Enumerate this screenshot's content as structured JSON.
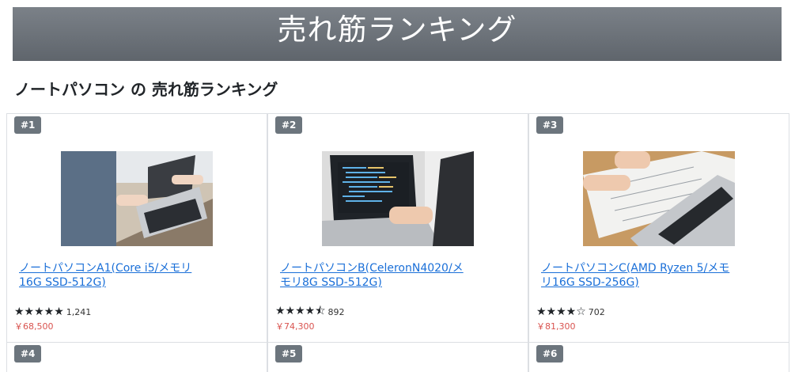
{
  "header": {
    "title": "売れ筋ランキング"
  },
  "section": {
    "title": "ノートパソコン の 売れ筋ランキング"
  },
  "products": [
    {
      "rank": "#1",
      "name": "ノートパソコンA1(Core i5/メモリ16G SSD-512G)",
      "stars": "★★★★★",
      "review_count": "1,241",
      "price": "￥68,500",
      "image": "laptop-photo"
    },
    {
      "rank": "#2",
      "name": "ノートパソコンB(CeleronN4020/メモリ8G SSD-512G)",
      "stars": "★★★★⯪",
      "review_count": "892",
      "price": "￥74,300",
      "image": "laptop-photo"
    },
    {
      "rank": "#3",
      "name": "ノートパソコンC(AMD Ryzen 5/メモリ16G SSD-256G)",
      "stars": "★★★★☆",
      "review_count": "702",
      "price": "￥81,300",
      "image": "laptop-photo"
    },
    {
      "rank": "#4"
    },
    {
      "rank": "#5"
    },
    {
      "rank": "#6"
    }
  ],
  "colors": {
    "banner": "#6c737a",
    "badge": "#6c757d",
    "link": "#1a6fd8",
    "price": "#d9534f"
  }
}
